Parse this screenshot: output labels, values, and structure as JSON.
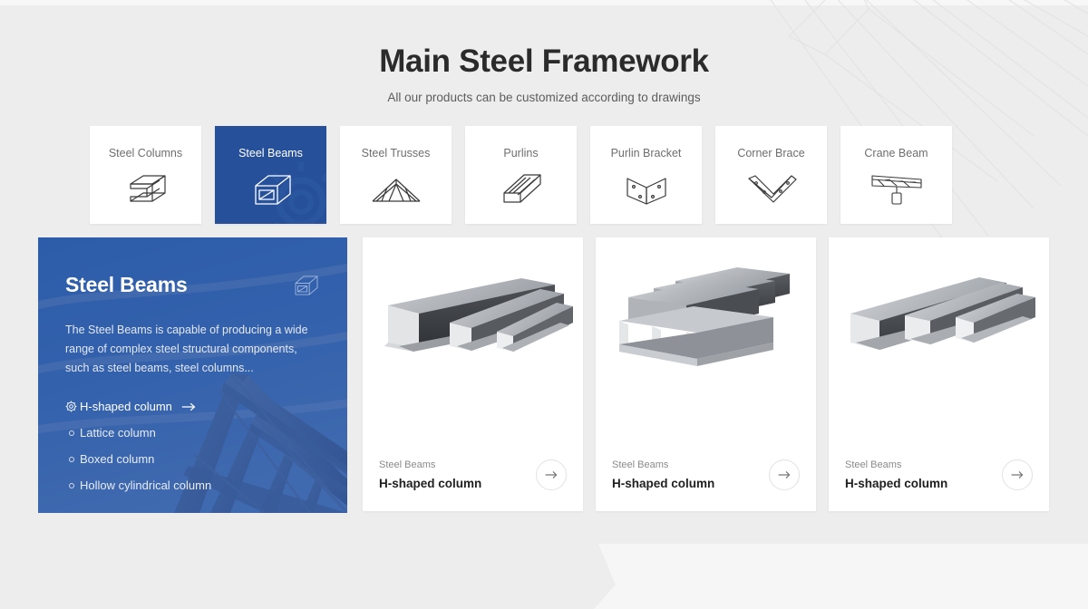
{
  "header": {
    "title": "Main Steel Framework",
    "subtitle": "All our products can be customized according to drawings"
  },
  "colors": {
    "accent_blue": "#27509b",
    "page_background": "#ededed",
    "card_background": "#ffffff",
    "muted_text": "#6e6e6e"
  },
  "tabs": [
    {
      "label": "Steel Columns",
      "icon": "h-beam-icon",
      "active": false
    },
    {
      "label": "Steel Beams",
      "icon": "box-beam-icon",
      "active": true
    },
    {
      "label": "Steel Trusses",
      "icon": "truss-icon",
      "active": false
    },
    {
      "label": "Purlins",
      "icon": "purlin-icon",
      "active": false
    },
    {
      "label": "Purlin Bracket",
      "icon": "bracket-icon",
      "active": false
    },
    {
      "label": "Corner Brace",
      "icon": "corner-brace-icon",
      "active": false
    },
    {
      "label": "Crane Beam",
      "icon": "crane-beam-icon",
      "active": false
    }
  ],
  "feature_panel": {
    "title": "Steel Beams",
    "icon": "box-beam-icon",
    "description": "The Steel Beams is capable of producing a wide range of complex steel structural components, such as steel beams, steel columns...",
    "items": [
      {
        "label": "H-shaped column",
        "active": true,
        "bullet": "gear-icon",
        "arrow": "arrow-right-icon"
      },
      {
        "label": "Lattice column",
        "active": false,
        "bullet": "circle-bullet"
      },
      {
        "label": "Boxed column",
        "active": false,
        "bullet": "circle-bullet"
      },
      {
        "label": "Hollow cylindrical column",
        "active": false,
        "bullet": "circle-bullet"
      }
    ]
  },
  "cards": [
    {
      "category": "Steel Beams",
      "name": "H-shaped column",
      "image": "h-beams-row-photo",
      "arrow": "arrow-right-icon"
    },
    {
      "category": "Steel Beams",
      "name": "H-shaped column",
      "image": "h-beams-stack-photo",
      "arrow": "arrow-right-icon"
    },
    {
      "category": "Steel Beams",
      "name": "H-shaped column",
      "image": "h-beams-triple-photo",
      "arrow": "arrow-right-icon"
    }
  ]
}
